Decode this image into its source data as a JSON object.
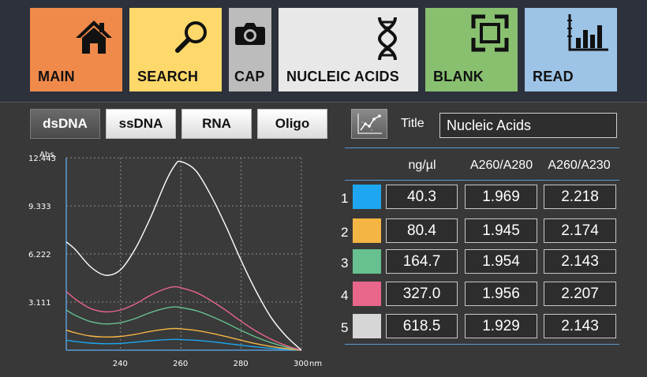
{
  "nav": {
    "main": "MAIN",
    "search": "SEARCH",
    "cap": "CAP",
    "nucleic": "NUCLEIC ACIDS",
    "blank": "BLANK",
    "read": "READ"
  },
  "colors": {
    "main": "#f08a4b",
    "search": "#fdd86a",
    "cap": "#bcbcbc",
    "nucleic": "#e8e8e8",
    "blank": "#88c070",
    "read": "#9dc3e6",
    "axis": "#5a9bd6"
  },
  "tabs": [
    "dsDNA",
    "ssDNA",
    "RNA",
    "Oligo"
  ],
  "title_label": "Title",
  "title_value": "Nucleic Acids",
  "table": {
    "headers": [
      "ng/µl",
      "A260/A280",
      "A260/A230"
    ],
    "rows": [
      {
        "num": "1",
        "color": "#1ea7f0",
        "conc": "40.3",
        "r280": "1.969",
        "r230": "2.218"
      },
      {
        "num": "2",
        "color": "#f5b544",
        "conc": "80.4",
        "r280": "1.945",
        "r230": "2.174"
      },
      {
        "num": "3",
        "color": "#66c08f",
        "conc": "164.7",
        "r280": "1.954",
        "r230": "2.143"
      },
      {
        "num": "4",
        "color": "#e8668a",
        "conc": "327.0",
        "r280": "1.956",
        "r230": "2.207"
      },
      {
        "num": "5",
        "color": "#d6d6d6",
        "conc": "618.5",
        "r280": "1.929",
        "r230": "2.143"
      }
    ]
  },
  "chart_data": {
    "type": "line",
    "ylabel": "Abs.",
    "xunit": "nm",
    "xlim": [
      222,
      300
    ],
    "ylim": [
      0,
      12.443
    ],
    "yticks": [
      "12.443",
      "9.333",
      "6.222",
      "3.111"
    ],
    "xticks": [
      "240",
      "260",
      "280",
      "300"
    ],
    "grid": true,
    "series": [
      {
        "color": "#1ea7f0",
        "x": [
          222,
          225,
          230,
          235,
          240,
          245,
          250,
          255,
          258,
          260,
          265,
          270,
          275,
          280,
          285,
          290,
          295,
          300
        ],
        "y": [
          0.65,
          0.56,
          0.46,
          0.42,
          0.44,
          0.52,
          0.61,
          0.68,
          0.7,
          0.69,
          0.64,
          0.55,
          0.44,
          0.32,
          0.21,
          0.12,
          0.05,
          0.0
        ]
      },
      {
        "color": "#f5b544",
        "x": [
          222,
          225,
          230,
          235,
          240,
          245,
          250,
          255,
          258,
          260,
          265,
          270,
          275,
          280,
          285,
          290,
          295,
          300
        ],
        "y": [
          1.3,
          1.12,
          0.92,
          0.85,
          0.89,
          1.03,
          1.22,
          1.36,
          1.4,
          1.38,
          1.28,
          1.1,
          0.88,
          0.64,
          0.42,
          0.24,
          0.1,
          0.0
        ]
      },
      {
        "color": "#66c08f",
        "x": [
          222,
          225,
          230,
          235,
          240,
          245,
          250,
          255,
          258,
          260,
          265,
          270,
          275,
          280,
          285,
          290,
          295,
          300
        ],
        "y": [
          2.6,
          2.25,
          1.85,
          1.7,
          1.78,
          2.06,
          2.44,
          2.72,
          2.8,
          2.76,
          2.56,
          2.2,
          1.76,
          1.28,
          0.84,
          0.48,
          0.2,
          0.0
        ]
      },
      {
        "color": "#e8668a",
        "x": [
          222,
          225,
          230,
          235,
          240,
          245,
          250,
          255,
          258,
          260,
          265,
          270,
          275,
          280,
          285,
          290,
          295,
          300
        ],
        "y": [
          3.8,
          3.3,
          2.7,
          2.48,
          2.6,
          3.0,
          3.56,
          3.98,
          4.1,
          4.04,
          3.74,
          3.21,
          2.57,
          1.87,
          1.23,
          0.7,
          0.29,
          0.0
        ]
      },
      {
        "color": "#ffffff",
        "x": [
          222,
          225,
          230,
          235,
          240,
          245,
          250,
          255,
          258,
          260,
          265,
          270,
          275,
          280,
          285,
          290,
          295,
          300
        ],
        "y": [
          7.0,
          6.5,
          5.4,
          4.85,
          5.2,
          6.6,
          8.6,
          10.9,
          11.95,
          12.2,
          11.6,
          10.0,
          8.0,
          5.8,
          3.8,
          2.1,
          0.9,
          0.0
        ]
      }
    ]
  }
}
